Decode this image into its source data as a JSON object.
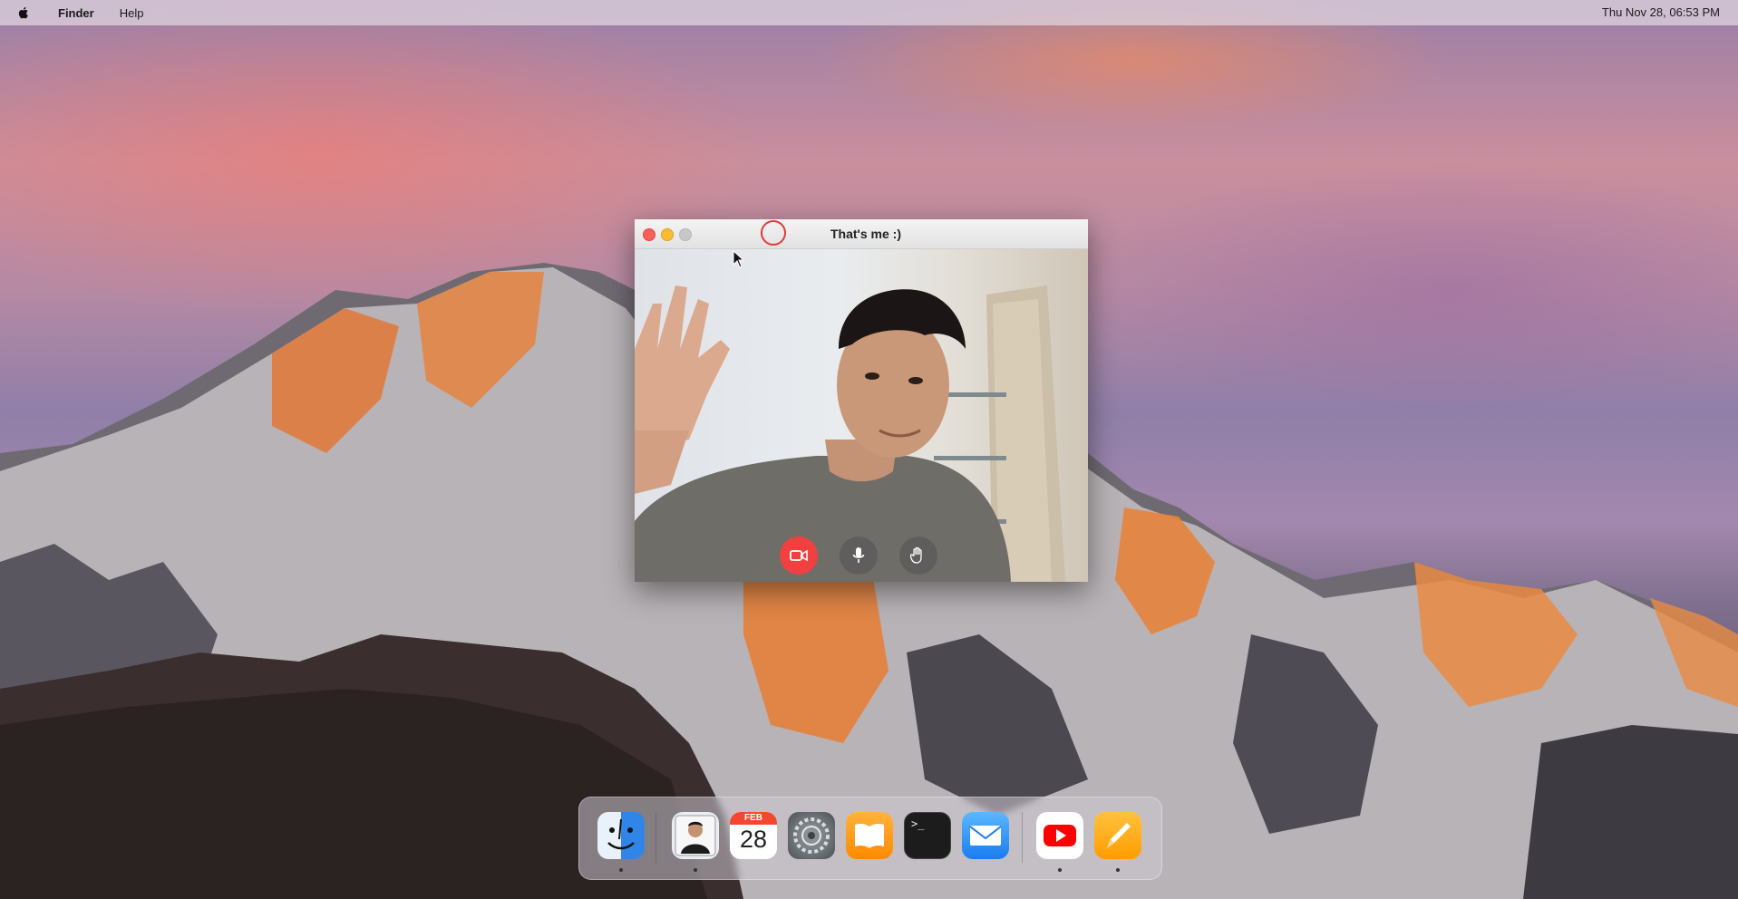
{
  "menubar": {
    "apple_icon": "apple-logo-icon",
    "items": [
      "Finder",
      "Help"
    ],
    "clock": "Thu Nov 28, 06:53 PM"
  },
  "window": {
    "title": "That's me :)",
    "traffic_lights": [
      "close",
      "minimize",
      "maximize"
    ],
    "controls": [
      {
        "name": "camera",
        "icon": "video-camera-icon",
        "color": "#f04040"
      },
      {
        "name": "microphone",
        "icon": "microphone-icon"
      },
      {
        "name": "raise-hand",
        "icon": "hand-icon"
      }
    ]
  },
  "dock": {
    "apps": [
      {
        "name": "Finder",
        "icon": "finder-icon",
        "running": true
      },
      {
        "name": "Photo",
        "icon": "profile-photo-icon",
        "running": true
      },
      {
        "name": "Calendar",
        "icon": "calendar-icon",
        "month": "FEB",
        "day": "28",
        "running": false
      },
      {
        "name": "System Preferences",
        "icon": "settings-gear-icon",
        "running": false
      },
      {
        "name": "Books",
        "icon": "books-icon",
        "running": false
      },
      {
        "name": "Terminal",
        "icon": "terminal-icon",
        "prompt": ">_",
        "running": false
      },
      {
        "name": "Mail",
        "icon": "mail-icon",
        "running": false
      },
      {
        "name": "YouTube",
        "icon": "youtube-icon",
        "running": true
      },
      {
        "name": "Pages",
        "icon": "pages-pencil-icon",
        "running": true
      }
    ]
  }
}
